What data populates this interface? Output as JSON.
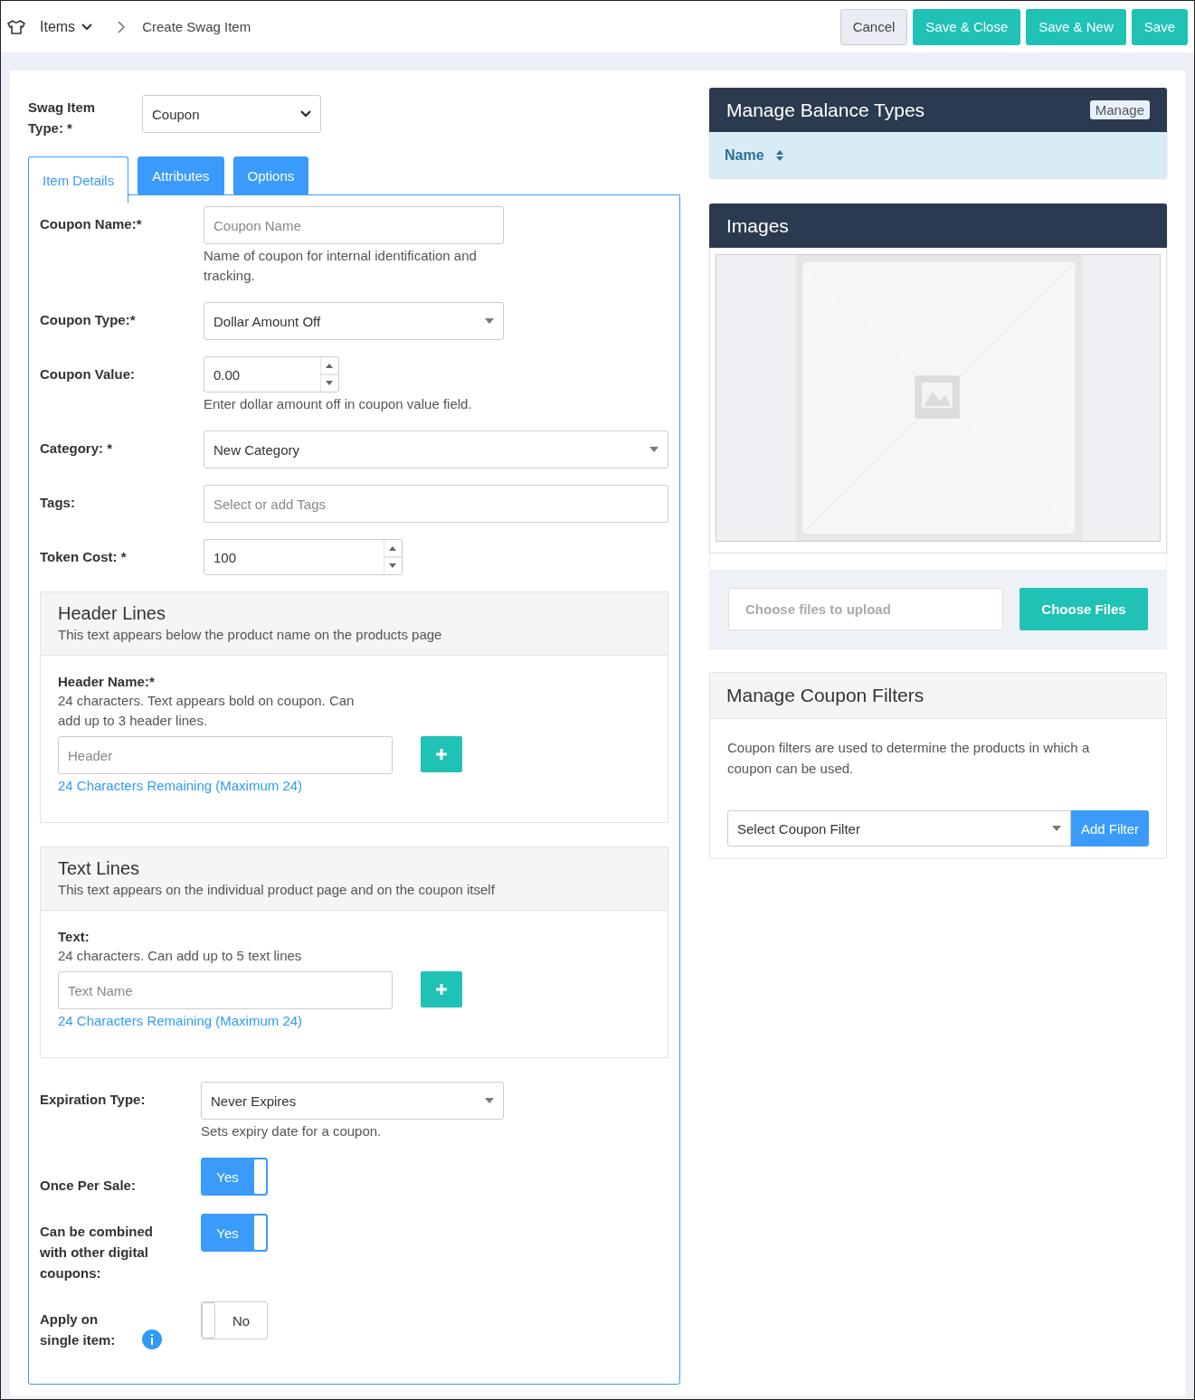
{
  "breadcrumb": {
    "section": "Items",
    "current": "Create Swag Item"
  },
  "actions": [
    {
      "label": "Cancel",
      "kind": "secondary"
    },
    {
      "label": "Save & Close",
      "kind": "primary"
    },
    {
      "label": "Save & New",
      "kind": "primary"
    },
    {
      "label": "Save",
      "kind": "primary"
    }
  ],
  "item_type": {
    "label": "Swag Item Type: *",
    "value": "Coupon"
  },
  "tabs": [
    {
      "label": "Item Details",
      "selected": true
    },
    {
      "label": "Attributes",
      "selected": false
    },
    {
      "label": "Options",
      "selected": false
    }
  ],
  "fields": [
    {
      "kind": "text",
      "label": "Coupon Name:*",
      "placeholder": "Coupon Name",
      "help": "Name of coupon for internal identification and tracking."
    },
    {
      "kind": "select",
      "label": "Coupon Type:*",
      "value": "Dollar Amount Off"
    },
    {
      "kind": "number",
      "label": "Coupon Value:",
      "value": "0.00",
      "help": "Enter dollar amount off in coupon value field."
    },
    {
      "kind": "select_wide",
      "label": "Category: *",
      "value": "New Category"
    },
    {
      "kind": "tags",
      "label": "Tags:",
      "placeholder": "Select or add Tags"
    },
    {
      "kind": "number_wide",
      "label": "Token Cost: *",
      "value": "100"
    }
  ],
  "sections": [
    {
      "title": "Header Lines",
      "subtitle": "This text appears below the product name on the products page",
      "field_label": "Header Name:*",
      "help": "24 characters. Text appears bold on coupon. Can add up to 3 header lines.",
      "placeholder": "Header",
      "counter": "24 Characters Remaining (Maximum 24)"
    },
    {
      "title": "Text Lines",
      "subtitle": "This text appears on the individual product page and on the coupon itself",
      "field_label": "Text:",
      "help": "24 characters. Can add up to 5 text lines",
      "placeholder": "Text Name",
      "counter": "24 Characters Remaining (Maximum 24)"
    }
  ],
  "expiration": {
    "label": "Expiration Type:",
    "value": "Never Expires",
    "help": "Sets expiry date for a coupon."
  },
  "toggles": [
    {
      "label": "Once Per Sale:",
      "text": "Yes",
      "on": true,
      "info": false
    },
    {
      "label": "Can be combined with other digital coupons:",
      "text": "Yes",
      "on": true,
      "info": false
    },
    {
      "label": "Apply on single item:",
      "text": "No",
      "on": false,
      "info": true
    }
  ],
  "balance_panel": {
    "title": "Manage Balance Types",
    "button": "Manage",
    "column": "Name"
  },
  "images_panel": {
    "title": "Images",
    "upload_placeholder": "Choose files to upload",
    "button": "Choose Files"
  },
  "filters_panel": {
    "title": "Manage Coupon Filters",
    "description": "Coupon filters are used to determine the products in which a coupon can be used.",
    "select_placeholder": "Select Coupon Filter",
    "button": "Add Filter"
  }
}
